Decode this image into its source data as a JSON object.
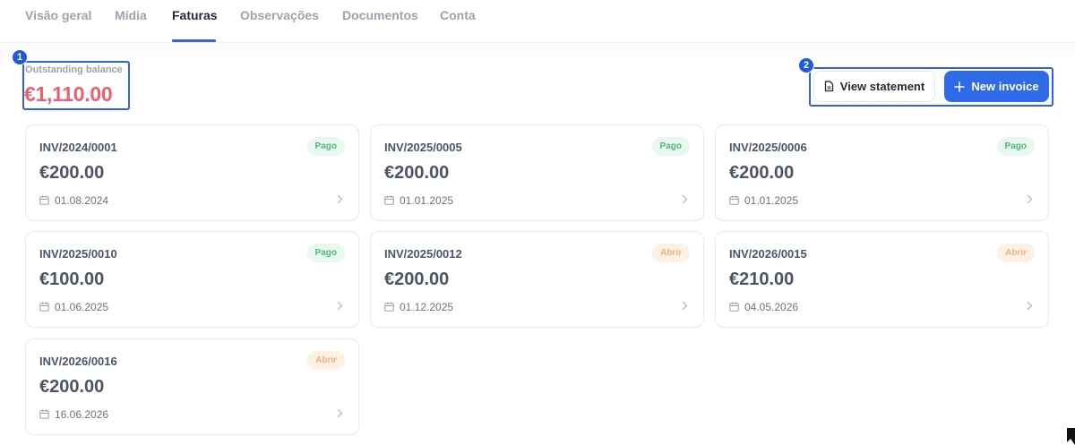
{
  "tabs": [
    {
      "label": "Visão geral",
      "active": false
    },
    {
      "label": "Mídia",
      "active": false
    },
    {
      "label": "Faturas",
      "active": true
    },
    {
      "label": "Observações",
      "active": false
    },
    {
      "label": "Documentos",
      "active": false
    },
    {
      "label": "Conta",
      "active": false
    }
  ],
  "annotations": [
    "1",
    "2"
  ],
  "balance": {
    "label": "Outstanding balance",
    "value": "€1,110.00",
    "color": "#ec5f6d"
  },
  "actions": {
    "statement_label": "View statement",
    "new_invoice_label": "New invoice"
  },
  "status_colors": {
    "paid": "#4bb979",
    "open": "#f0b27a",
    "accent": "#2f6be8"
  },
  "invoices": [
    {
      "number": "INV/2024/0001",
      "amount": "€200.00",
      "date": "01.08.2024",
      "status": "Pago",
      "state": "paid"
    },
    {
      "number": "INV/2025/0005",
      "amount": "€200.00",
      "date": "01.01.2025",
      "status": "Pago",
      "state": "paid"
    },
    {
      "number": "INV/2025/0006",
      "amount": "€200.00",
      "date": "01.01.2025",
      "status": "Pago",
      "state": "paid"
    },
    {
      "number": "INV/2025/0010",
      "amount": "€100.00",
      "date": "01.06.2025",
      "status": "Pago",
      "state": "paid"
    },
    {
      "number": "INV/2025/0012",
      "amount": "€200.00",
      "date": "01.12.2025",
      "status": "Abrir",
      "state": "open"
    },
    {
      "number": "INV/2026/0015",
      "amount": "€210.00",
      "date": "04.05.2026",
      "status": "Abrir",
      "state": "open"
    },
    {
      "number": "INV/2026/0016",
      "amount": "€200.00",
      "date": "16.06.2026",
      "status": "Abrir",
      "state": "open"
    }
  ]
}
